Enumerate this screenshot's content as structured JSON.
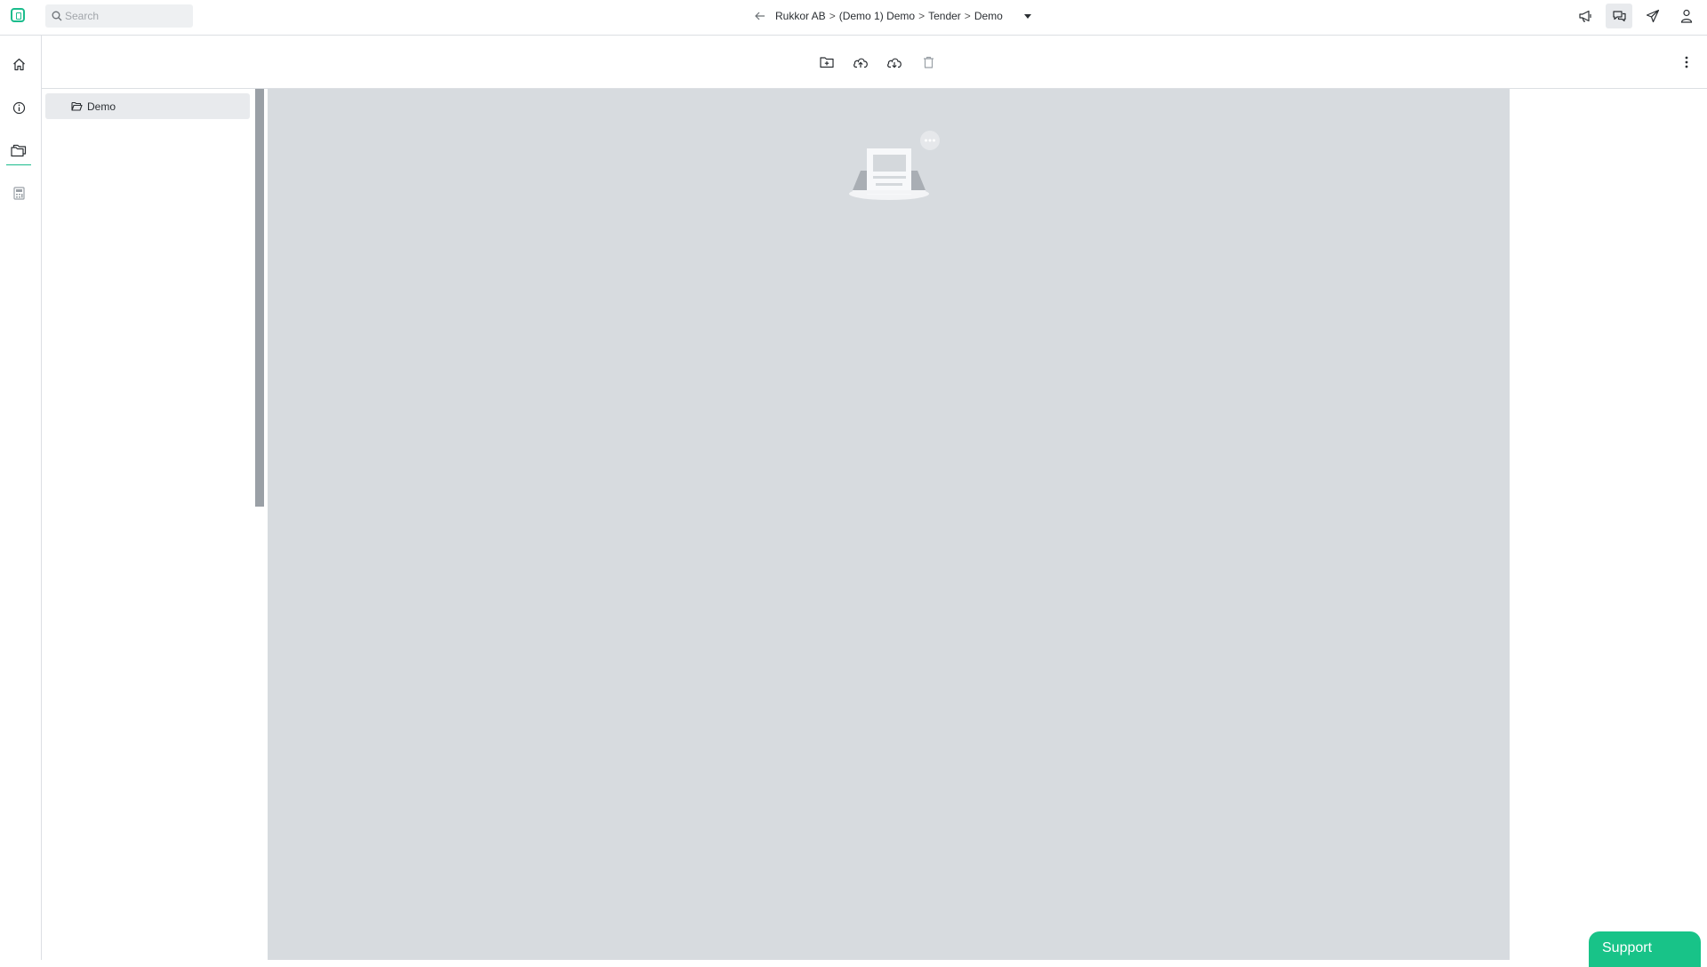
{
  "search": {
    "placeholder": "Search"
  },
  "breadcrumb": {
    "items": [
      "Rukkor AB",
      "(Demo 1) Demo",
      "Tender",
      "Demo"
    ],
    "separator": ">"
  },
  "top_actions": [
    {
      "icon": "megaphone-icon"
    },
    {
      "icon": "chat-icon",
      "active": true
    },
    {
      "icon": "send-icon"
    },
    {
      "icon": "user-icon"
    }
  ],
  "rail": [
    {
      "icon": "home-icon"
    },
    {
      "icon": "info-icon"
    },
    {
      "icon": "folders-icon",
      "active": true
    },
    {
      "icon": "calculator-icon"
    }
  ],
  "toolbar": {
    "tools": [
      "new-folder-icon",
      "upload-icon",
      "download-icon",
      "trash-icon"
    ],
    "more": "more-vertical-icon"
  },
  "tree": {
    "items": [
      {
        "label": "Demo",
        "icon": "folder-open-icon"
      }
    ]
  },
  "support": {
    "label": "Support"
  },
  "colors": {
    "accent": "#1abc8c",
    "support": "#18c388",
    "content_bg": "#d7dbdf"
  }
}
